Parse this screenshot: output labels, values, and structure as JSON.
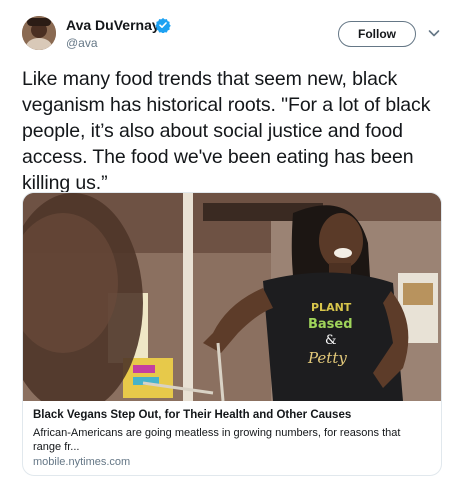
{
  "author": {
    "name": "Ava DuVernay",
    "handle": "@ava",
    "avatar_icon": "profile-avatar",
    "verified_icon": "verified-badge-icon"
  },
  "actions": {
    "follow_label": "Follow",
    "menu_icon": "chevron-down-icon"
  },
  "tweet": {
    "text": "Like many food trends that seem new, black veganism has historical roots. \"For a lot of black people, it’s also about social justice and food access. The food we've been eating has been killing us.”"
  },
  "card": {
    "title": "Black Vegans Step Out, for Their Health and Other Causes",
    "description": "African-Americans are going meatless in growing numbers, for reasons that range fr...",
    "domain": "mobile.nytimes.com",
    "shirt_text_top": "PLANT",
    "shirt_text_mid": "Based",
    "shirt_text_amp": "&",
    "shirt_text_bottom": "Petty"
  },
  "colors": {
    "text_primary": "#14171a",
    "text_secondary": "#657786",
    "verified_blue": "#1da1f2",
    "border": "#e1e8ed"
  }
}
